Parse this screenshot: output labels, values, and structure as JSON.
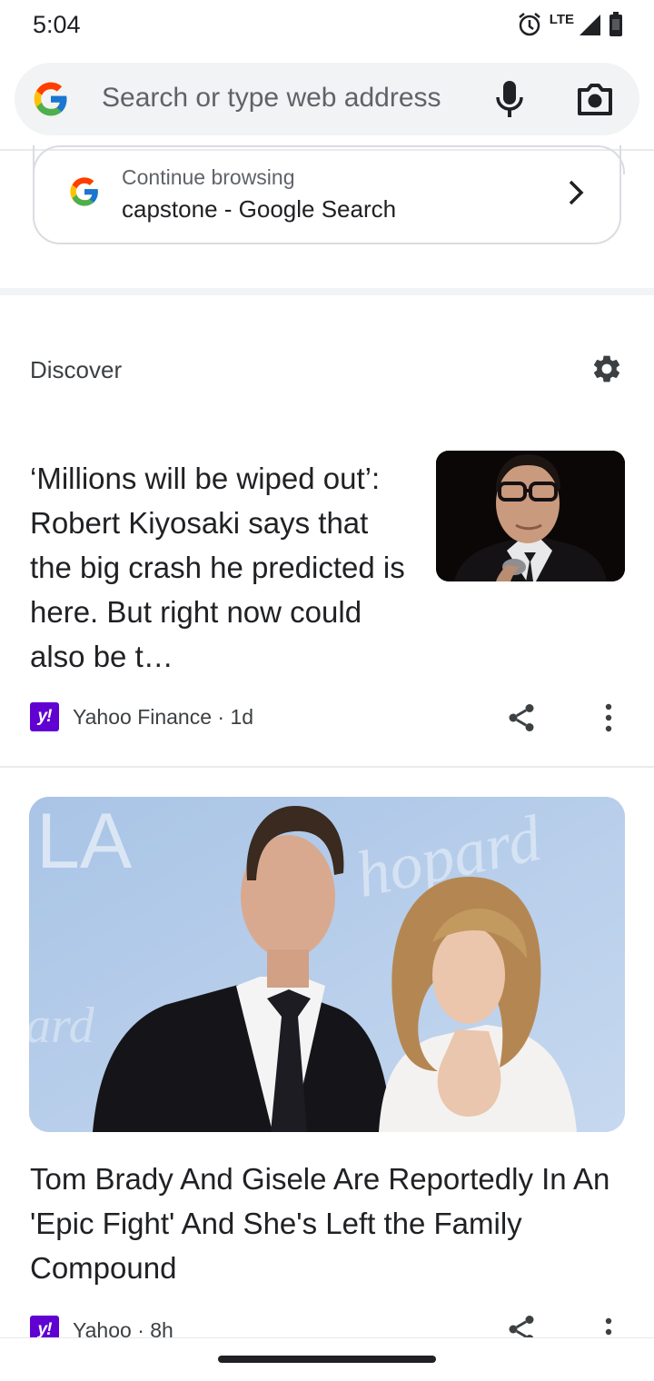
{
  "status_bar": {
    "time": "5:04",
    "network": "LTE",
    "icons": [
      "alarm-icon",
      "signal-icon",
      "battery-icon"
    ]
  },
  "omnibox": {
    "placeholder": "Search or type web address",
    "icons": [
      "google-g-icon",
      "microphone-icon",
      "camera-icon"
    ]
  },
  "continue_card": {
    "title": "Continue browsing",
    "subtitle": "capstone - Google Search"
  },
  "discover": {
    "title": "Discover",
    "settings_icon": "gear-icon"
  },
  "articles": [
    {
      "title": "‘Millions will be wiped out’: Robert Kiyosaki says that the big crash he predicted is here. But right now could also be t…",
      "source_logo": "y!",
      "source": "Yahoo Finance · 1d",
      "image": "man-with-glasses-thumbnail"
    },
    {
      "title": "Tom Brady And Gisele Are Reportedly In An 'Epic Fight' And She's Left the Family Compound",
      "source_logo": "y!",
      "source": "Yahoo · 8h",
      "image": "couple-photo",
      "image_backdrop_text": [
        "LA",
        "hopard",
        "ard"
      ]
    }
  ],
  "colors": {
    "yahoo_purple": "#6001d2",
    "text_primary": "#202124",
    "text_secondary": "#5f6368",
    "omnibox_bg": "#f1f3f4"
  }
}
